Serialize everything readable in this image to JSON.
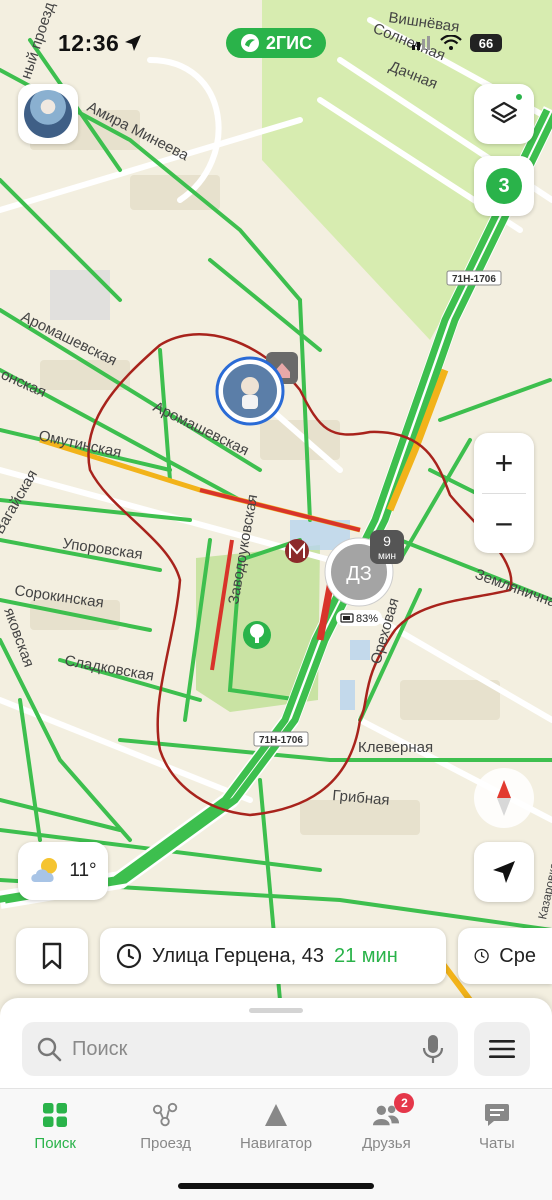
{
  "status_bar": {
    "time": "12:36",
    "battery": "66"
  },
  "brand": {
    "name": "2ГИС"
  },
  "map": {
    "streets": {
      "proezd": "ный проезд",
      "minneeva": "Амира Минеева",
      "aromash_1": "Аромашевская",
      "aromash_2": "Аромашевская",
      "onskaya": "онская",
      "omutinskaya": "Омутинская",
      "vagayskaya": "Вагайская",
      "uporovskaya": "Упоровская",
      "sorokinskaya": "Сорокинская",
      "yakovskaya": "яковская",
      "sladkovskaya": "Сладковская",
      "zavodoukovskaya": "Заводоуковская",
      "vishnevaya": "Вишнёвая",
      "solnechnaya": "Солнечная",
      "dachnaya": "Дачная",
      "orekhovaya": "Ореховая",
      "zemlyanichnaya": "Земляничная",
      "klevernaya": "Клеверная",
      "gribnaya": "Грибная",
      "kazarovka": "Казаровка"
    },
    "road_codes": {
      "upper": "71Н-1706",
      "lower": "71Н-1706"
    },
    "friend_marker": {
      "initials": "ДЗ",
      "eta_value": "9",
      "eta_unit": "мин",
      "battery": "83%"
    },
    "metro_icon": "metro-icon",
    "park_icon": "park-tree-icon"
  },
  "controls": {
    "zoom_in": "+",
    "zoom_out": "−",
    "score": "3",
    "weather_temp": "11°"
  },
  "quick_routes": [
    {
      "address": "Улица Герцена, 43",
      "eta": "21 мин"
    },
    {
      "address": "Сре",
      "eta": ""
    }
  ],
  "search": {
    "placeholder": "Поиск"
  },
  "tabs": [
    {
      "label": "Поиск",
      "icon": "grid-icon",
      "active": true
    },
    {
      "label": "Проезд",
      "icon": "route-icon",
      "active": false
    },
    {
      "label": "Навигатор",
      "icon": "navigator-icon",
      "active": false
    },
    {
      "label": "Друзья",
      "icon": "friends-icon",
      "active": false,
      "badge": "2"
    },
    {
      "label": "Чаты",
      "icon": "chat-icon",
      "active": false
    }
  ],
  "colors": {
    "accent": "#2ab34a",
    "traffic_free": "#3dbf4e",
    "traffic_slow": "#f2b31a",
    "traffic_jam": "#d8342a",
    "drawn_outline": "#a8231c",
    "badge": "#e5374a"
  }
}
